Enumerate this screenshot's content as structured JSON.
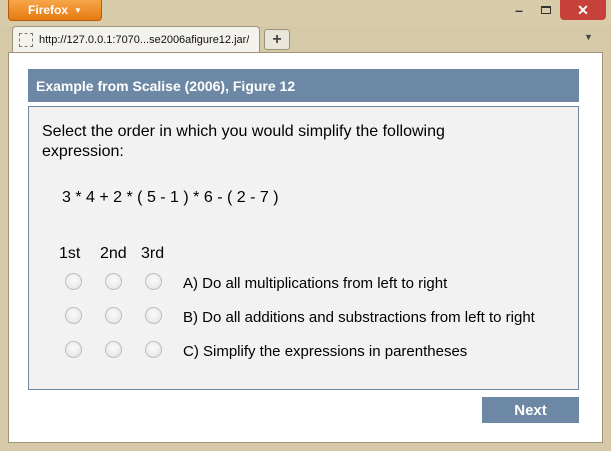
{
  "browser": {
    "menu_label": "Firefox",
    "tab_url": "http://127.0.0.1:7070...se2006afigure12.jar/",
    "new_tab_symbol": "+"
  },
  "item": {
    "header": "Example from Scalise (2006), Figure 12",
    "prompt": "Select the order in which you would simplify the following expression:",
    "expression": "3 * 4 + 2 * ( 5 - 1 ) * 6 - ( 2 - 7 )",
    "columns": [
      "1st",
      "2nd",
      "3rd"
    ],
    "options": [
      "A) Do all multiplications from left to right",
      "B) Do all additions and substractions from left to right",
      "C) Simplify the expressions in parentheses"
    ]
  },
  "footer": {
    "next_label": "Next"
  }
}
